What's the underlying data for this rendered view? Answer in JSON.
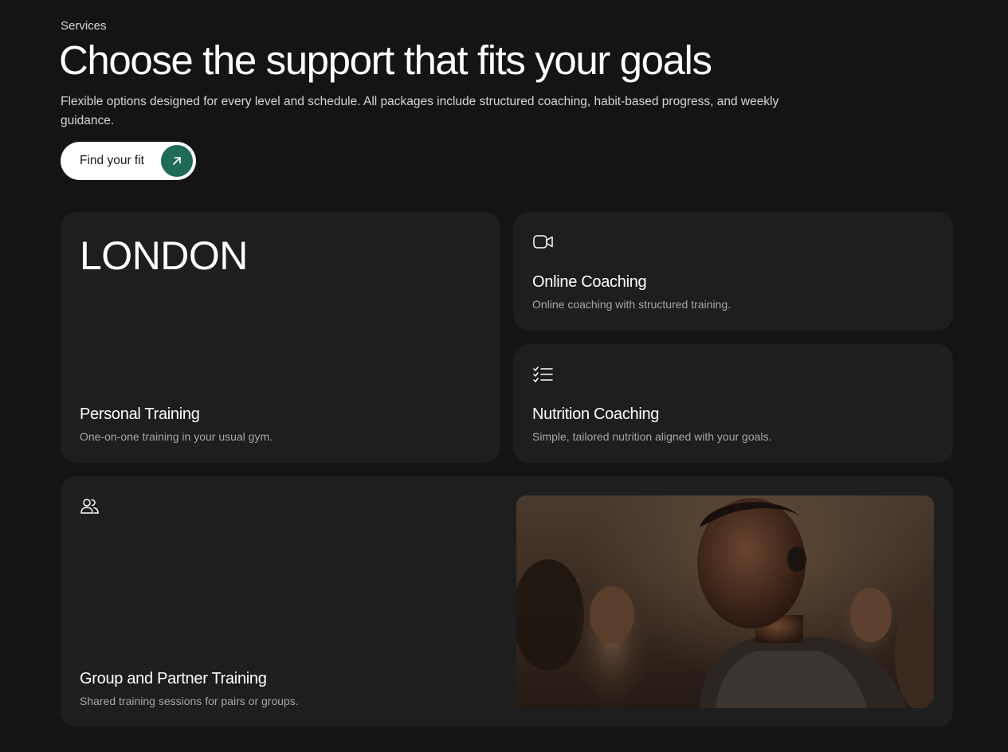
{
  "header": {
    "eyebrow": "Services",
    "title": "Choose the support that fits your goals",
    "subtitle": "Flexible options designed for every level and schedule. All packages include structured coaching, habit-based progress, and weekly guidance.",
    "cta_label": "Find your fit"
  },
  "cards": {
    "london": {
      "wordmark": "LONDON",
      "title": "Personal Training",
      "description": "One-on-one training in your usual gym."
    },
    "online": {
      "icon": "video-camera-icon",
      "title": "Online Coaching",
      "description": "Online coaching with structured training."
    },
    "nutrition": {
      "icon": "checklist-icon",
      "title": "Nutrition Coaching",
      "description": "Simple, tailored nutrition aligned with your goals."
    },
    "group": {
      "icon": "users-icon",
      "title": "Group and Partner Training",
      "description": "Shared training sessions for pairs or groups."
    }
  },
  "colors": {
    "background": "#141414",
    "card": "#1e1e1e",
    "accent": "#1f6b58",
    "cta_background": "#ffffff"
  }
}
